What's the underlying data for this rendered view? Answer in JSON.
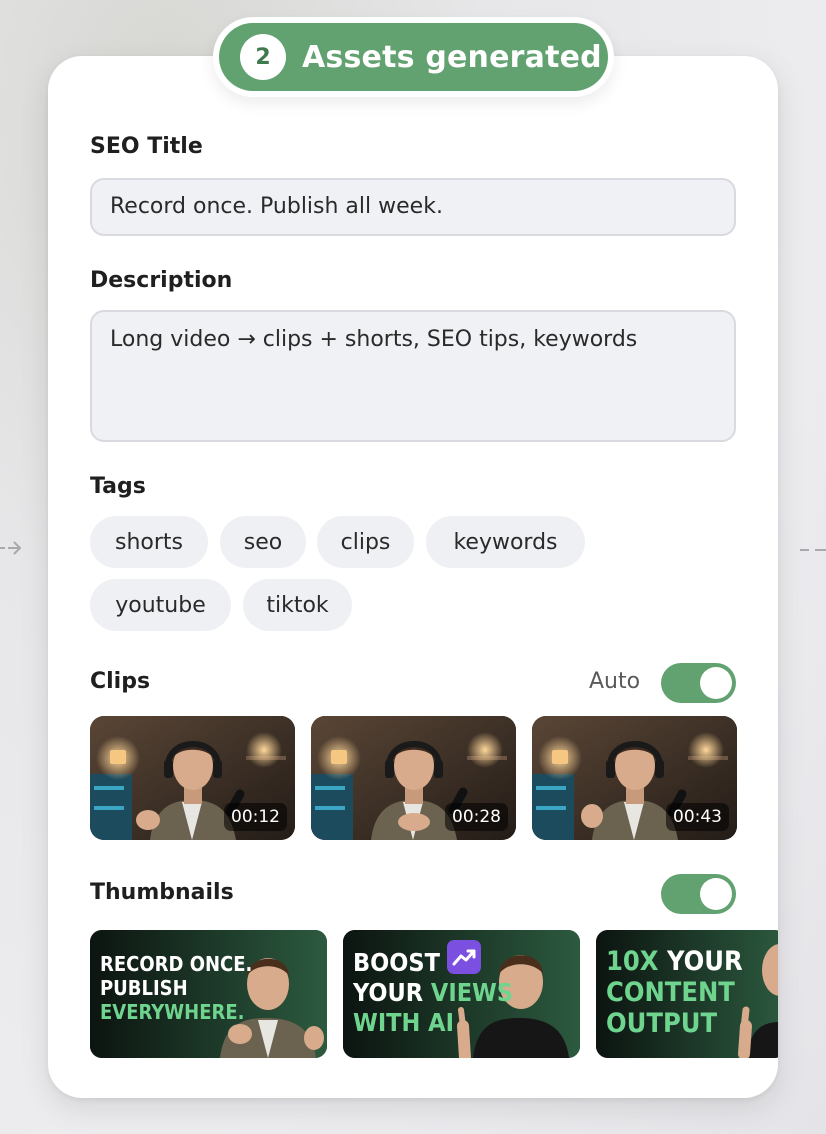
{
  "badge": {
    "step": "2",
    "text": "Assets generated"
  },
  "seo_title": {
    "label": "SEO Title",
    "value": "Record once. Publish all week."
  },
  "description": {
    "label": "Description",
    "value": "Long video → clips + shorts, SEO tips, keywords"
  },
  "tags": {
    "label": "Tags",
    "items": [
      "shorts",
      "seo",
      "clips",
      "keywords",
      "youtube",
      "tiktok"
    ]
  },
  "clips": {
    "label": "Clips",
    "auto_label": "Auto",
    "auto_enabled": true,
    "items": [
      {
        "duration": "00:12"
      },
      {
        "duration": "00:28"
      },
      {
        "duration": "00:43"
      }
    ]
  },
  "thumbnails": {
    "label": "Thumbnails",
    "enabled": true,
    "items": [
      {
        "lines": [
          "RECORD ONCE.",
          "PUBLISH",
          "EVERYWHERE."
        ],
        "highlight_line": 2
      },
      {
        "lines": [
          "BOOST",
          "YOUR VIEWS",
          "WITH AI"
        ],
        "icon": "trending-up-icon"
      },
      {
        "lines": [
          "10x YOUR",
          "CONTENT",
          "OUTPUT"
        ]
      }
    ]
  },
  "colors": {
    "accent": "#62a271",
    "field_bg": "#f0f1f4",
    "tag_bg": "#eef0f3",
    "thumb_highlight": "#6fd58e"
  }
}
